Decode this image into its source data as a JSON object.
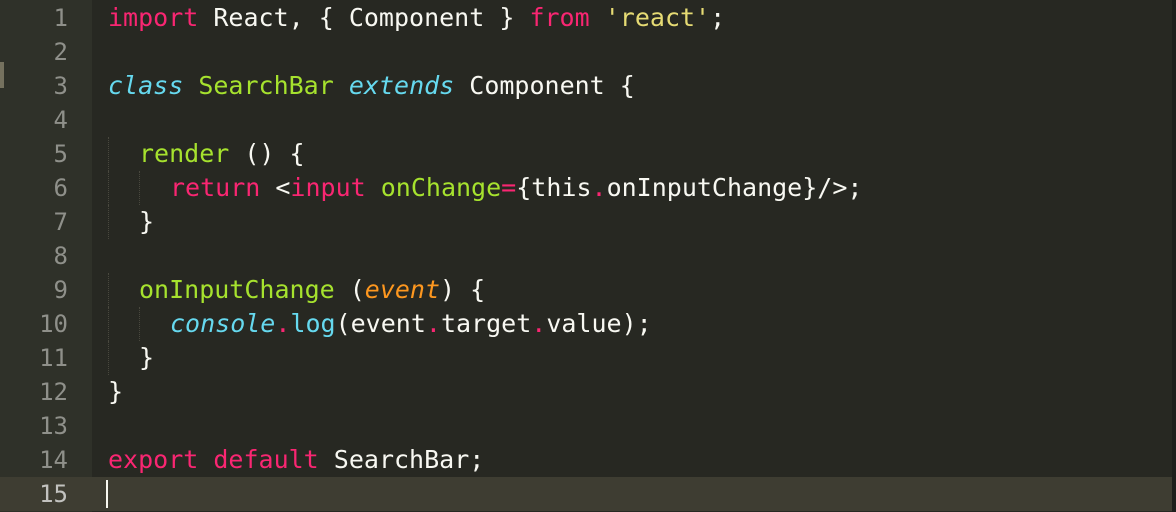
{
  "editor": {
    "theme": "Monokai",
    "colors": {
      "background": "#272822",
      "gutter": "#2f3129",
      "current_line": "#3e3d32",
      "line_number": "#8f908a",
      "text": "#f8f8f2",
      "keyword": "#f92672",
      "string": "#e6db74",
      "function": "#a6e22e",
      "type": "#66d9ef",
      "parameter": "#fd971f"
    },
    "current_line": 15
  },
  "lines": [
    {
      "number": "1",
      "indent": 0,
      "tokens": [
        {
          "text": "import",
          "color": "#f92672",
          "italic": false
        },
        {
          "text": " React, { Component } ",
          "color": "#f8f8f2",
          "italic": false
        },
        {
          "text": "from",
          "color": "#f92672",
          "italic": false
        },
        {
          "text": " ",
          "color": "#f8f8f2",
          "italic": false
        },
        {
          "text": "'react'",
          "color": "#e6db74",
          "italic": false
        },
        {
          "text": ";",
          "color": "#f8f8f2",
          "italic": false
        }
      ]
    },
    {
      "number": "2",
      "indent": 0,
      "tokens": []
    },
    {
      "number": "3",
      "indent": 0,
      "tokens": [
        {
          "text": "class",
          "color": "#66d9ef",
          "italic": true
        },
        {
          "text": " ",
          "color": "#f8f8f2",
          "italic": false
        },
        {
          "text": "SearchBar",
          "color": "#a6e22e",
          "italic": false
        },
        {
          "text": " ",
          "color": "#f8f8f2",
          "italic": false
        },
        {
          "text": "extends",
          "color": "#66d9ef",
          "italic": true
        },
        {
          "text": " Component {",
          "color": "#f8f8f2",
          "italic": false
        }
      ]
    },
    {
      "number": "4",
      "indent": 0,
      "tokens": []
    },
    {
      "number": "5",
      "indent": 1,
      "tokens": [
        {
          "text": "render",
          "color": "#a6e22e",
          "italic": false
        },
        {
          "text": " () {",
          "color": "#f8f8f2",
          "italic": false
        }
      ]
    },
    {
      "number": "6",
      "indent": 2,
      "tokens": [
        {
          "text": "return",
          "color": "#f92672",
          "italic": false
        },
        {
          "text": " <",
          "color": "#f8f8f2",
          "italic": false
        },
        {
          "text": "input",
          "color": "#f92672",
          "italic": false
        },
        {
          "text": " ",
          "color": "#f8f8f2",
          "italic": false
        },
        {
          "text": "onChange",
          "color": "#a6e22e",
          "italic": false
        },
        {
          "text": "=",
          "color": "#f92672",
          "italic": false
        },
        {
          "text": "{this",
          "color": "#f8f8f2",
          "italic": false
        },
        {
          "text": ".",
          "color": "#f92672",
          "italic": false
        },
        {
          "text": "onInputChange}/>;",
          "color": "#f8f8f2",
          "italic": false
        }
      ]
    },
    {
      "number": "7",
      "indent": 1,
      "tokens": [
        {
          "text": "}",
          "color": "#f8f8f2",
          "italic": false
        }
      ]
    },
    {
      "number": "8",
      "indent": 0,
      "tokens": []
    },
    {
      "number": "9",
      "indent": 1,
      "tokens": [
        {
          "text": "onInputChange",
          "color": "#a6e22e",
          "italic": false
        },
        {
          "text": " (",
          "color": "#f8f8f2",
          "italic": false
        },
        {
          "text": "event",
          "color": "#fd971f",
          "italic": true
        },
        {
          "text": ") {",
          "color": "#f8f8f2",
          "italic": false
        }
      ]
    },
    {
      "number": "10",
      "indent": 2,
      "tokens": [
        {
          "text": "console",
          "color": "#66d9ef",
          "italic": true
        },
        {
          "text": ".",
          "color": "#f92672",
          "italic": false
        },
        {
          "text": "log",
          "color": "#66d9ef",
          "italic": false
        },
        {
          "text": "(event",
          "color": "#f8f8f2",
          "italic": false
        },
        {
          "text": ".",
          "color": "#f92672",
          "italic": false
        },
        {
          "text": "target",
          "color": "#f8f8f2",
          "italic": false
        },
        {
          "text": ".",
          "color": "#f92672",
          "italic": false
        },
        {
          "text": "value);",
          "color": "#f8f8f2",
          "italic": false
        }
      ]
    },
    {
      "number": "11",
      "indent": 1,
      "tokens": [
        {
          "text": "}",
          "color": "#f8f8f2",
          "italic": false
        }
      ]
    },
    {
      "number": "12",
      "indent": 0,
      "tokens": [
        {
          "text": "}",
          "color": "#f8f8f2",
          "italic": false
        }
      ]
    },
    {
      "number": "13",
      "indent": 0,
      "tokens": []
    },
    {
      "number": "14",
      "indent": 0,
      "tokens": [
        {
          "text": "export",
          "color": "#f92672",
          "italic": false
        },
        {
          "text": " ",
          "color": "#f8f8f2",
          "italic": false
        },
        {
          "text": "default",
          "color": "#f92672",
          "italic": false
        },
        {
          "text": " SearchBar;",
          "color": "#f8f8f2",
          "italic": false
        }
      ]
    },
    {
      "number": "15",
      "indent": 0,
      "tokens": []
    }
  ]
}
